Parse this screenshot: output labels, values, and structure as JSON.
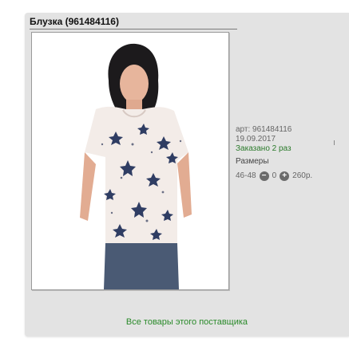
{
  "product": {
    "title": "Блузка (961484116)",
    "article": "арт: 961484116",
    "date": "19.09.2017",
    "ordered": "Заказано 2 раз",
    "sizes_label": "Размеры",
    "size": "46-48",
    "quantity": "0",
    "price": "260р.",
    "minus_symbol": "−",
    "plus_symbol": "+"
  },
  "footer": {
    "supplier_link": "Все товары этого поставщика"
  },
  "colors": {
    "panel_bg": "#e3e3e3",
    "link_green": "#2a8a2a",
    "ordered_green": "#2a7a2a"
  }
}
